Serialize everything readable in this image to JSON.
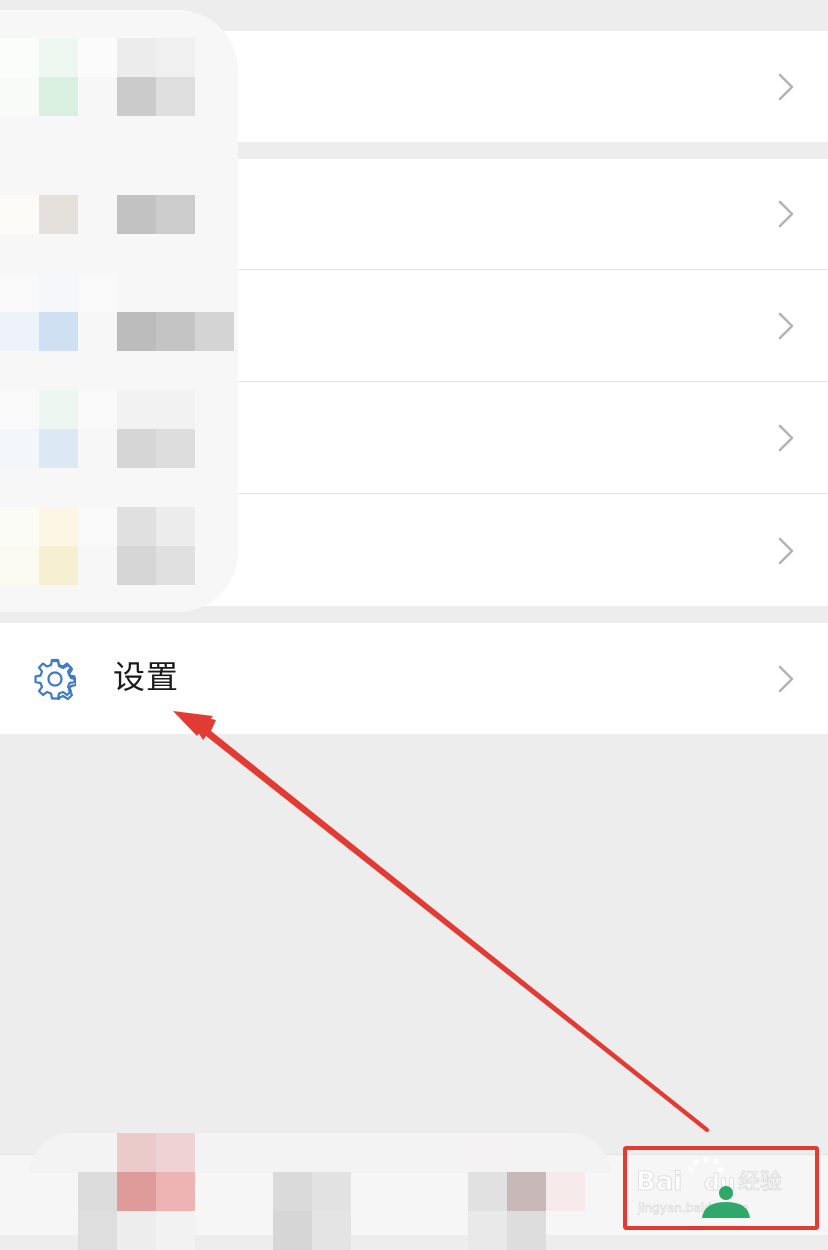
{
  "settings_item": {
    "label": "设置",
    "icon": "gear-icon"
  },
  "watermark": {
    "brand": "Bai",
    "brand_suffix": "du",
    "product": "经验",
    "url": "jingyan.baidu.com"
  },
  "colors": {
    "background": "#ededed",
    "cell": "#ffffff",
    "chevron": "#b3b3b3",
    "gear": "#3d7bc4",
    "annotation": "#e23b33"
  }
}
